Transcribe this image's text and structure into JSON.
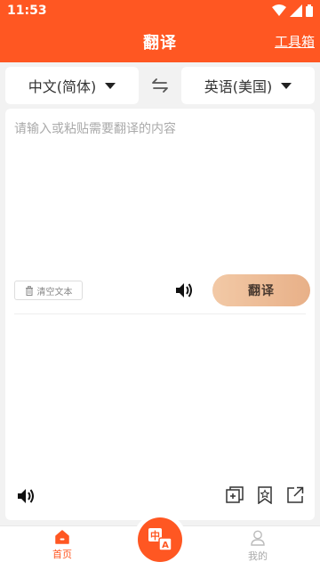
{
  "status_bar": {
    "time": "11:53"
  },
  "header": {
    "title": "翻译",
    "toolbox_label": "工具箱"
  },
  "language_bar": {
    "source_language": "中文(简体)",
    "target_language": "英语(美国)"
  },
  "input": {
    "placeholder": "请输入或粘贴需要翻译的内容",
    "value": ""
  },
  "actions": {
    "clear_label": "清空文本",
    "translate_label": "翻译"
  },
  "output": {
    "text": ""
  },
  "bottom_nav": {
    "home_label": "首页",
    "mine_label": "我的",
    "fab_zh_glyph": "中",
    "fab_en_glyph": "A"
  },
  "colors": {
    "brand": "#ff5722",
    "translate_gradient_start": "#f2c9a6",
    "translate_gradient_end": "#e8b088"
  }
}
